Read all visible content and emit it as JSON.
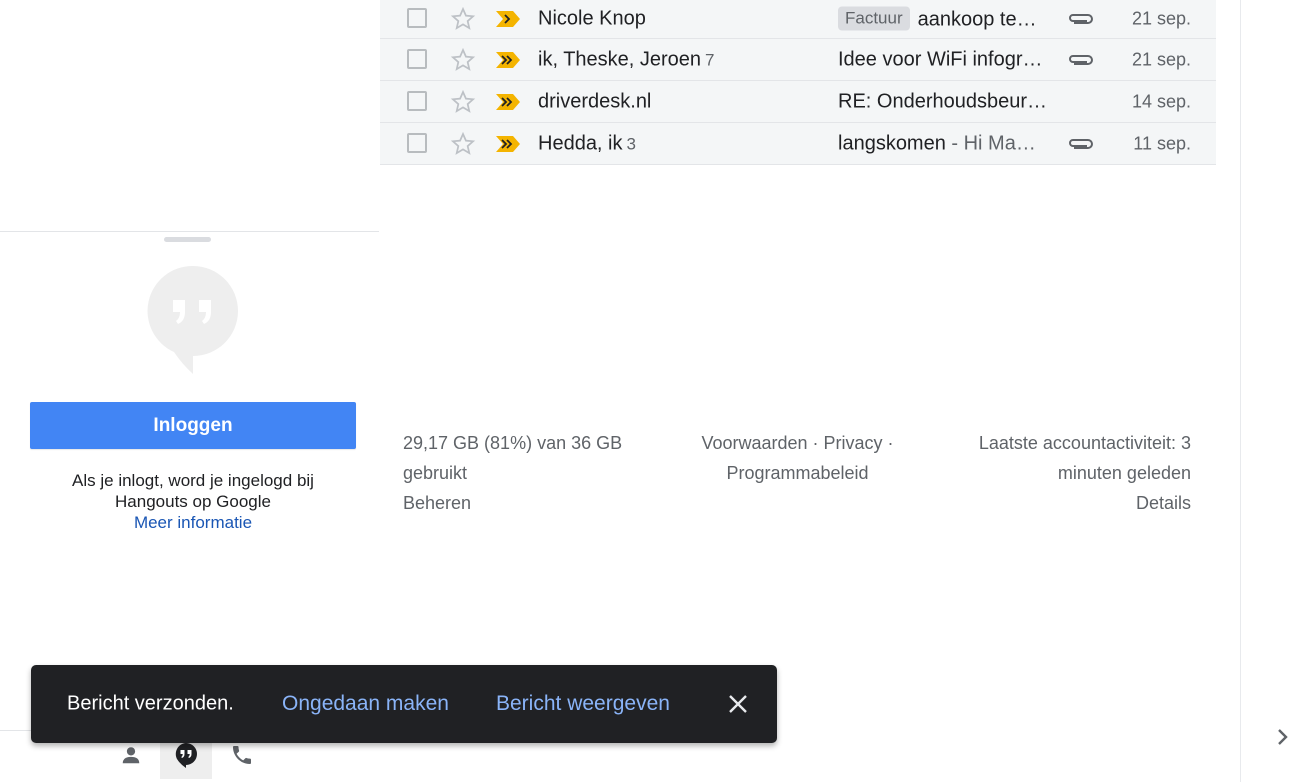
{
  "emails": [
    {
      "sender": "Nicole Knop",
      "count": "",
      "label": "Factuur",
      "subject": "aankoop te…",
      "snippet": "",
      "attachment": true,
      "date": "21 sep."
    },
    {
      "sender": "ik, Theske, Jeroen",
      "count": "7",
      "label": "",
      "subject": "Idee voor WiFi infogr…",
      "snippet": "",
      "attachment": true,
      "date": "21 sep."
    },
    {
      "sender": "driverdesk.nl",
      "count": "",
      "label": "",
      "subject": "RE: Onderhoudsbeur…",
      "snippet": "",
      "attachment": false,
      "date": "14 sep."
    },
    {
      "sender": "Hedda, ik",
      "count": "3",
      "label": "",
      "subject": "langskomen",
      "snippet": " - Hi Ma…",
      "attachment": true,
      "date": "11 sep."
    }
  ],
  "hangouts": {
    "login_label": "Inloggen",
    "info_line1": "Als je inlogt, word je ingelogd bij",
    "info_line2": "Hangouts op Google",
    "more_info": "Meer informatie"
  },
  "footer": {
    "storage_line1": "29,17 GB (81%) van 36 GB",
    "storage_line2": "gebruikt",
    "manage": "Beheren",
    "terms": "Voorwaarden",
    "sep1": " · ",
    "privacy": "Privacy",
    "sep2": " ·",
    "program_policy": "Programmabeleid",
    "activity_line1": "Laatste accountactiviteit: 3",
    "activity_line2": "minuten geleden",
    "details": "Details"
  },
  "toast": {
    "message": "Bericht verzonden.",
    "undo": "Ongedaan maken",
    "view": "Bericht weergeven"
  },
  "colors": {
    "primary_button": "#4285f4",
    "toast_bg": "#202124",
    "toast_action": "#8ab4f8",
    "important_marker": "#f4b400",
    "link": "#1a56b4"
  },
  "icons": {
    "checkbox": "checkbox-icon",
    "star": "star-icon",
    "important": "important-marker-icon",
    "attachment": "paperclip-icon",
    "hangouts": "hangouts-quote-icon",
    "contacts": "person-icon",
    "chat": "chat-bubble-icon",
    "phone": "phone-icon",
    "close": "close-icon",
    "expand": "chevron-right-icon"
  }
}
